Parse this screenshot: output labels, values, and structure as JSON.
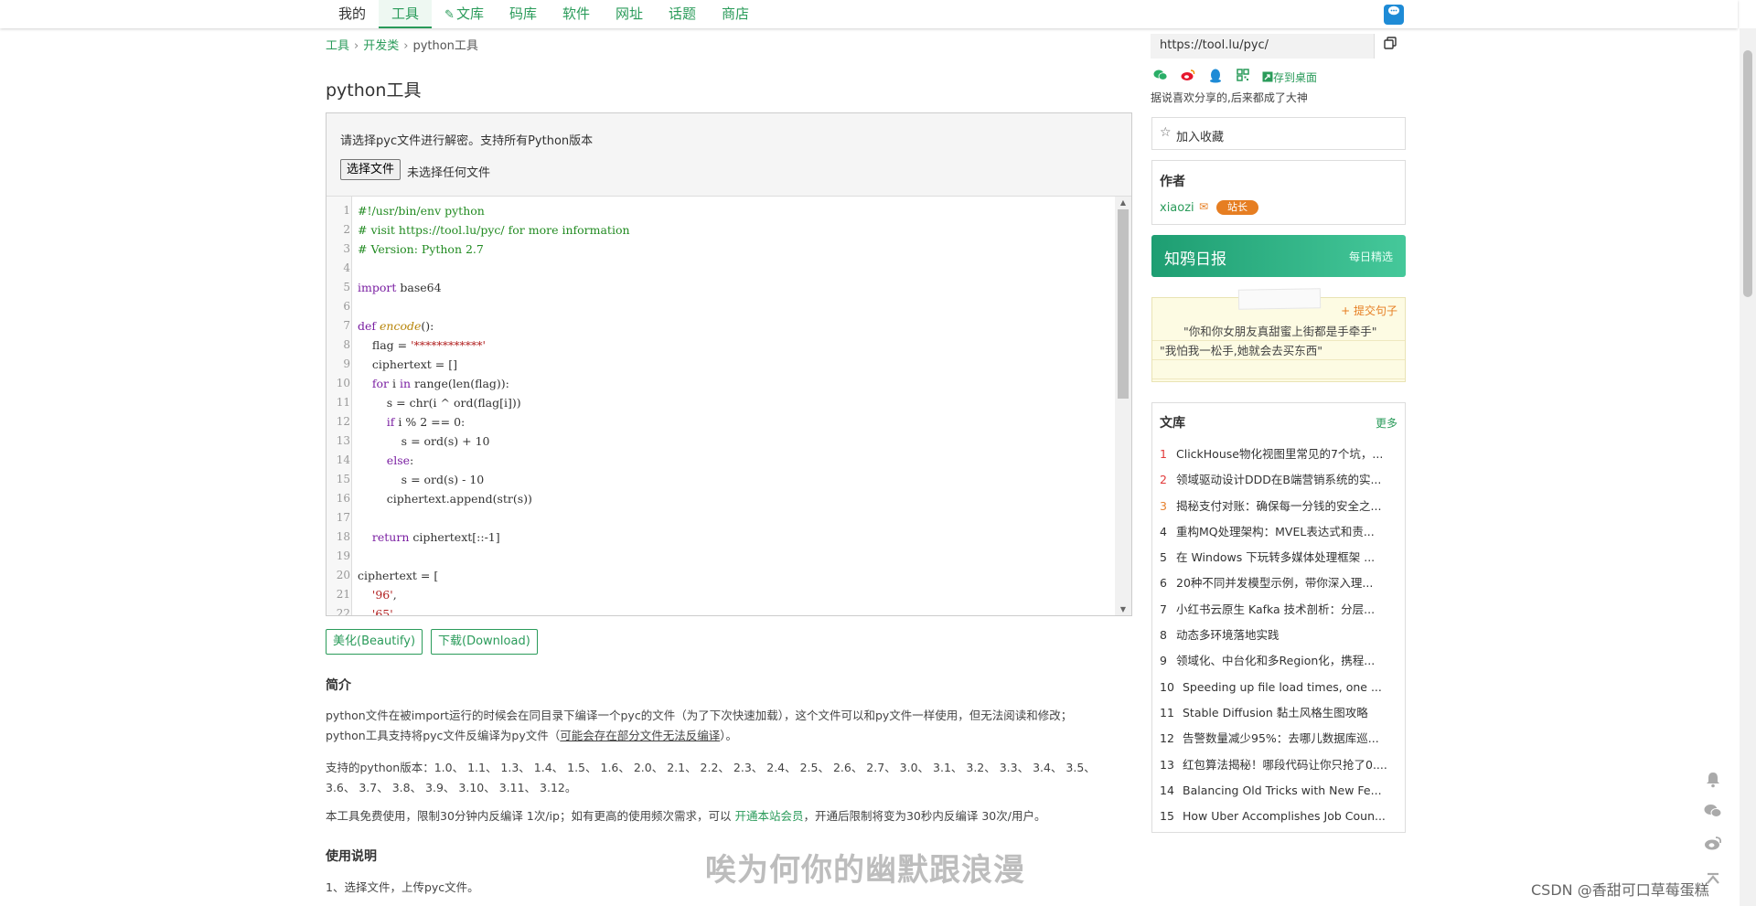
{
  "nav": {
    "items": [
      {
        "label": "我的",
        "icon": ""
      },
      {
        "label": "工具",
        "icon": ""
      },
      {
        "label": "文库",
        "icon": "pen-icon"
      },
      {
        "label": "码库",
        "icon": ""
      },
      {
        "label": "软件",
        "icon": ""
      },
      {
        "label": "网址",
        "icon": ""
      },
      {
        "label": "话题",
        "icon": ""
      },
      {
        "label": "商店",
        "icon": ""
      }
    ],
    "active_index": 1,
    "chat_icon": "chat-bubble-icon"
  },
  "breadcrumb": {
    "items": [
      "工具",
      "开发类"
    ],
    "current": "python工具",
    "separator": "›"
  },
  "page_title": "python工具",
  "tool": {
    "hint": "请选择pyc文件进行解密。支持所有Python版本",
    "file_button": "选择文件",
    "file_none": "未选择任何文件"
  },
  "editor": {
    "lines": [
      {
        "n": "1",
        "text": "#!/usr/bin/env python",
        "kind": "comment"
      },
      {
        "n": "2",
        "text": "# visit https://tool.lu/pyc/ for more information",
        "kind": "comment"
      },
      {
        "n": "3",
        "text": "# Version: Python 2.7",
        "kind": "comment"
      },
      {
        "n": "4",
        "text": "",
        "kind": "plain"
      },
      {
        "n": "5",
        "text": "import base64",
        "kind": "import"
      },
      {
        "n": "6",
        "text": "",
        "kind": "plain"
      },
      {
        "n": "7",
        "text": "def encode():",
        "kind": "def"
      },
      {
        "n": "8",
        "text": "    flag = '************'",
        "kind": "assign_str"
      },
      {
        "n": "9",
        "text": "    ciphertext = []",
        "kind": "plain"
      },
      {
        "n": "10",
        "text": "    for i in range(len(flag)):",
        "kind": "for"
      },
      {
        "n": "11",
        "text": "        s = chr(i ^ ord(flag[i]))",
        "kind": "plain"
      },
      {
        "n": "12",
        "text": "        if i % 2 == 0:",
        "kind": "if"
      },
      {
        "n": "13",
        "text": "            s = ord(s) + 10",
        "kind": "plain"
      },
      {
        "n": "14",
        "text": "        else:",
        "kind": "else"
      },
      {
        "n": "15",
        "text": "            s = ord(s) - 10",
        "kind": "plain"
      },
      {
        "n": "16",
        "text": "        ciphertext.append(str(s))",
        "kind": "plain"
      },
      {
        "n": "17",
        "text": "",
        "kind": "plain"
      },
      {
        "n": "18",
        "text": "    return ciphertext[::-1]",
        "kind": "return"
      },
      {
        "n": "19",
        "text": "",
        "kind": "plain"
      },
      {
        "n": "20",
        "text": "ciphertext = [",
        "kind": "plain"
      },
      {
        "n": "21",
        "text": "    '96',",
        "kind": "str"
      },
      {
        "n": "22",
        "text": "    '65',",
        "kind": "str"
      }
    ]
  },
  "actions": {
    "beautify": "美化(Beautify)",
    "download": "下载(Download)"
  },
  "intro": {
    "title": "简介",
    "p1_a": "python文件在被import运行的时候会在同目录下编译一个pyc的文件（为了下次快速加载），这个文件可以和py文件一样使用，但无法阅读和修改；",
    "p1_b": "python工具支持将pyc文件反编译为py文件（",
    "p1_underline": "可能会存在部分文件无法反编译",
    "p1_end": "）。",
    "p2": "支持的python版本：1.0、 1.1、 1.3、 1.4、 1.5、 1.6、 2.0、 2.1、 2.2、 2.3、 2.4、 2.5、 2.6、 2.7、 3.0、 3.1、 3.2、 3.3、 3.4、 3.5、 3.6、 3.7、 3.8、 3.9、 3.10、 3.11、 3.12。",
    "p3_a": "本工具免费使用，限制30分钟内反编译 1次/ip；如有更高的使用频次需求，可以 ",
    "p3_link": "开通本站会员",
    "p3_b": "，开通后限制将变为30秒内反编译 30次/用户。"
  },
  "usage": {
    "title": "使用说明",
    "step1": "1、选择文件，上传pyc文件。"
  },
  "sidebar": {
    "url": "https://tool.lu/pyc/",
    "copy_icon": "copy-icon",
    "share_icons": [
      "wechat-icon",
      "weibo-icon",
      "qq-icon",
      "qrcode-icon"
    ],
    "save_desktop": "存到桌面",
    "share_text": "据说喜欢分享的,后来都成了大神",
    "favorite": "加入收藏",
    "author": {
      "heading": "作者",
      "name": "xiaozi",
      "badge": "站长"
    },
    "zhihu": {
      "title": "知鸦日报",
      "sub": "每日精选"
    },
    "quote": {
      "submit": "+ 提交句子",
      "line1": "\"你和你女朋友真甜蜜上街都是手牵手\"",
      "line2": "\"我怕我一松手,她就会去买东西\""
    },
    "library": {
      "heading": "文库",
      "more": "更多",
      "items": [
        "ClickHouse物化视图里常见的7个坑，...",
        "领域驱动设计DDD在B端营销系统的实...",
        "揭秘支付对账：确保每一分钱的安全之...",
        "重构MQ处理架构：MVEL表达式和责...",
        "在 Windows 下玩转多媒体处理框架 ...",
        "20种不同并发模型示例，带你深入理...",
        "小红书云原生 Kafka 技术剖析：分层...",
        "动态多环境落地实践",
        "领域化、中台化和多Region化，携程...",
        "Speeding up file load times, one ...",
        "Stable Diffusion 黏土风格生图攻略",
        "告警数量减少95%：去哪儿数据库巡...",
        "红包算法揭秘！哪段代码让你只抢了0....",
        "Balancing Old Tricks with New Fe...",
        "How Uber Accomplishes Job Coun..."
      ]
    }
  },
  "float_icons": [
    "bell-icon",
    "wechat-icon",
    "weibo-icon",
    "back-to-top-icon"
  ],
  "overlay": {
    "subtitle": "唉为何你的幽默跟浪漫",
    "watermark": "CSDN @香甜可口草莓蛋糕"
  },
  "colors": {
    "accent": "#2a9b5a",
    "orange": "#e67e22",
    "hot": "#e23a3a"
  }
}
